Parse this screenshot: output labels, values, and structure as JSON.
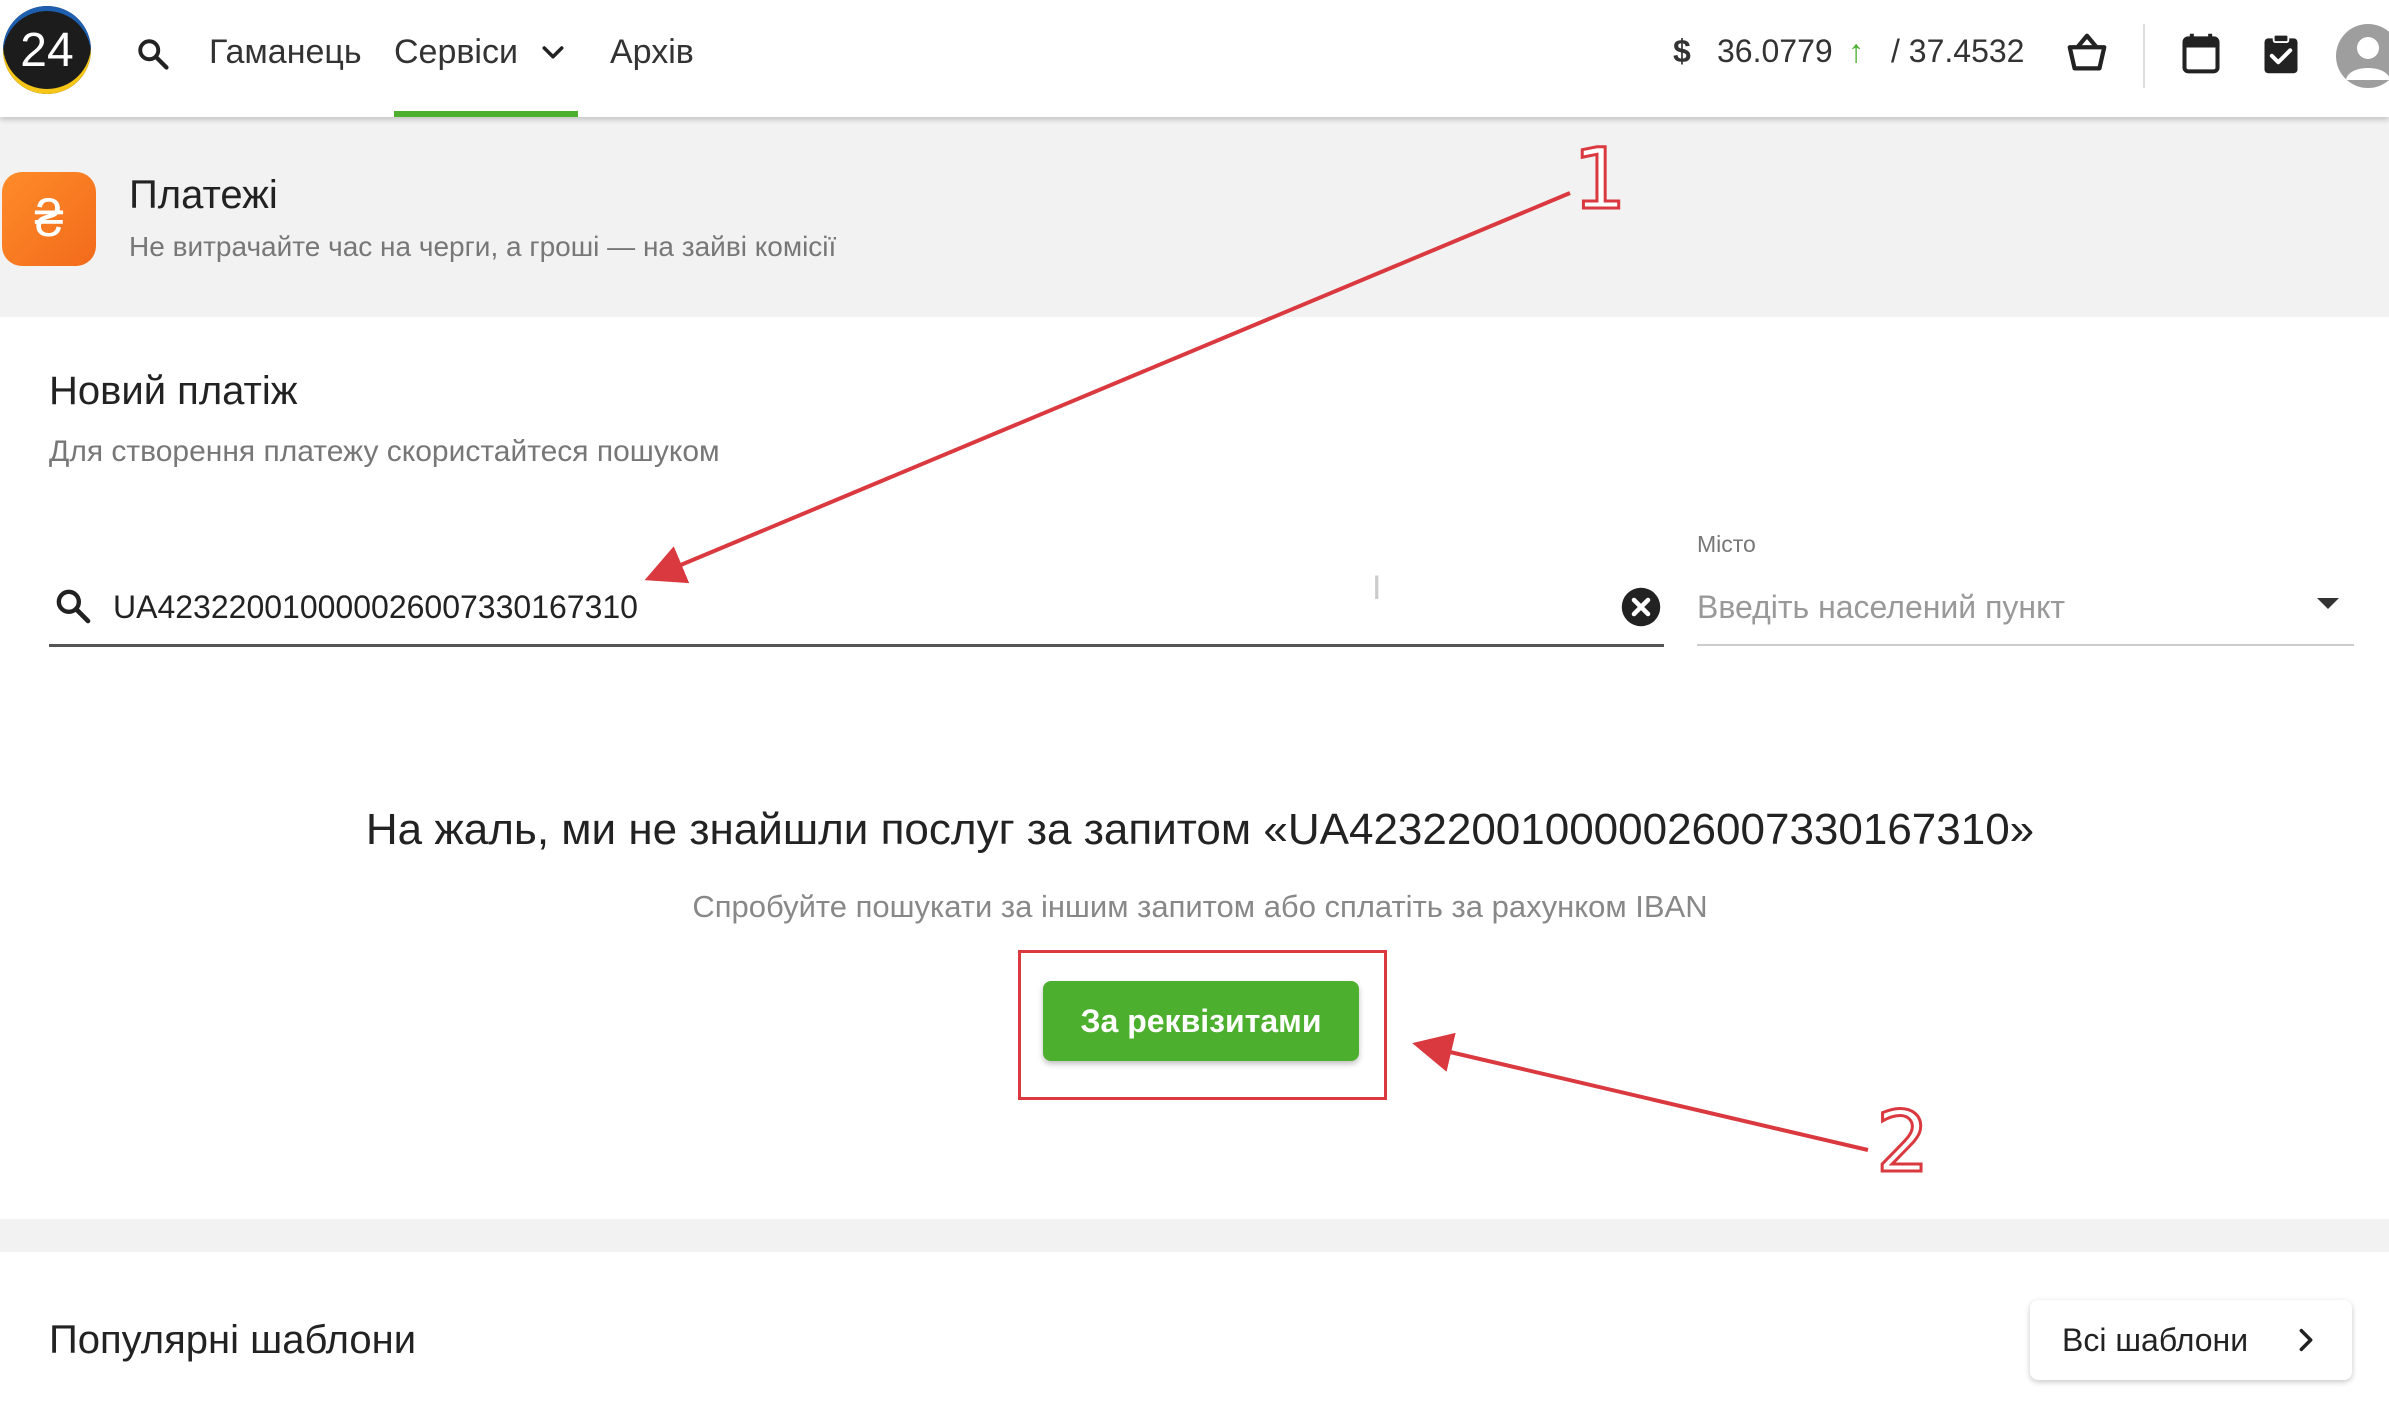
{
  "nav": {
    "logo": "24",
    "wallet": "Гаманець",
    "services": "Сервіси",
    "archive": "Архів",
    "currency_symbol": "$",
    "rate_buy": "36.0779",
    "rate_trend": "↑",
    "rate_sell": "/ 37.4532",
    "icons": [
      "search-icon",
      "chevron-down-icon",
      "basket-icon",
      "calendar-icon",
      "clipboard-check-icon",
      "avatar-icon"
    ]
  },
  "header": {
    "icon_symbol": "₴",
    "title": "Платежі",
    "subtitle": "Не витрачайте час на черги, а гроші — на зайві комісії"
  },
  "new_payment": {
    "title": "Новий платіж",
    "subtitle": "Для створення платежу скористайтеся пошуком",
    "search_value": "UA423220010000026007330167310",
    "city_label": "Місто",
    "city_placeholder": "Введіть населений пункт",
    "cursor_glyph": "I",
    "empty_title": "На жаль, ми не знайшли послуг за запитом «UA423220010000026007330167310»",
    "empty_hint": "Спробуйте пошукати за іншим запитом або сплатіть за рахунком IBAN",
    "details_button": "За реквізитами"
  },
  "popular_templates": {
    "title": "Популярні шаблони",
    "all_button": "Всі шаблони"
  },
  "annotations": {
    "label_1": "1",
    "label_2": "2",
    "color": "#d9393f"
  },
  "colors": {
    "accent_green": "#4caf2e",
    "payment_orange": "#f26a1b"
  }
}
